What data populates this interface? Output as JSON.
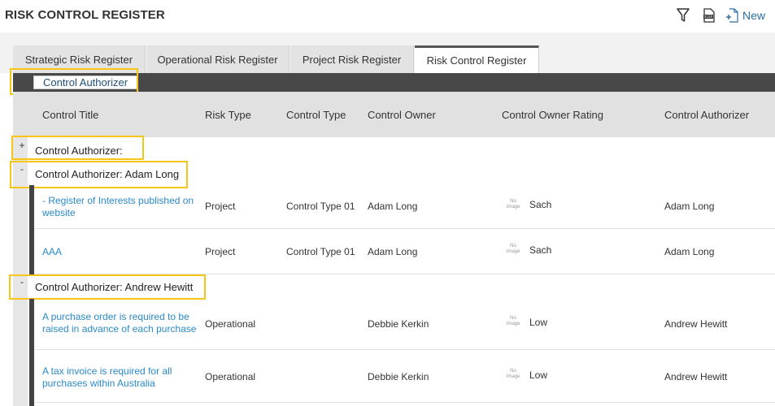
{
  "page": {
    "title": "RISK CONTROL REGISTER"
  },
  "toolbar": {
    "filter_icon": "filter-icon",
    "export_icon": "xlsx-export-icon",
    "new_icon": "new-document-icon",
    "new_label": "New"
  },
  "tabs": [
    {
      "label": "Strategic Risk Register",
      "active": false
    },
    {
      "label": "Operational Risk Register",
      "active": false
    },
    {
      "label": "Project Risk Register",
      "active": false
    },
    {
      "label": "Risk Control Register",
      "active": true
    }
  ],
  "grouping": {
    "chip_label": "Control Authorizer"
  },
  "columns": [
    "Control Title",
    "Risk Type",
    "Control Type",
    "Control Owner",
    "Control Owner Rating",
    "Control Authorizer"
  ],
  "groups": [
    {
      "toggle": "+",
      "label": "Control Authorizer:"
    },
    {
      "toggle": "-",
      "label": "Control Authorizer: Adam Long"
    },
    {
      "toggle": "-",
      "label": "Control Authorizer: Andrew Hewitt"
    }
  ],
  "rows": [
    {
      "title": "- Register of Interests published on website",
      "risk_type": "Project",
      "control_type": "Control Type 01",
      "owner": "Adam Long",
      "no_image": "No Image",
      "rating": "Sach",
      "authorizer": "Adam Long"
    },
    {
      "title": "AAA",
      "risk_type": "Project",
      "control_type": "Control Type 01",
      "owner": "Adam Long",
      "no_image": "No Image",
      "rating": "Sach",
      "authorizer": "Adam Long"
    },
    {
      "title": "A purchase order is required to be raised in advance of each purchase",
      "risk_type": "Operational",
      "control_type": "",
      "owner": "Debbie Kerkin",
      "no_image": "No Image",
      "rating": "Low",
      "authorizer": "Andrew Hewitt"
    },
    {
      "title": "A tax invoice is required for all purchases within Australia",
      "risk_type": "Operational",
      "control_type": "",
      "owner": "Debbie Kerkin",
      "no_image": "No Image",
      "rating": "Low",
      "authorizer": "Andrew Hewitt"
    }
  ],
  "colors": {
    "link": "#2a8ac9",
    "highlight": "#f5c518",
    "group_bar": "#484848"
  }
}
